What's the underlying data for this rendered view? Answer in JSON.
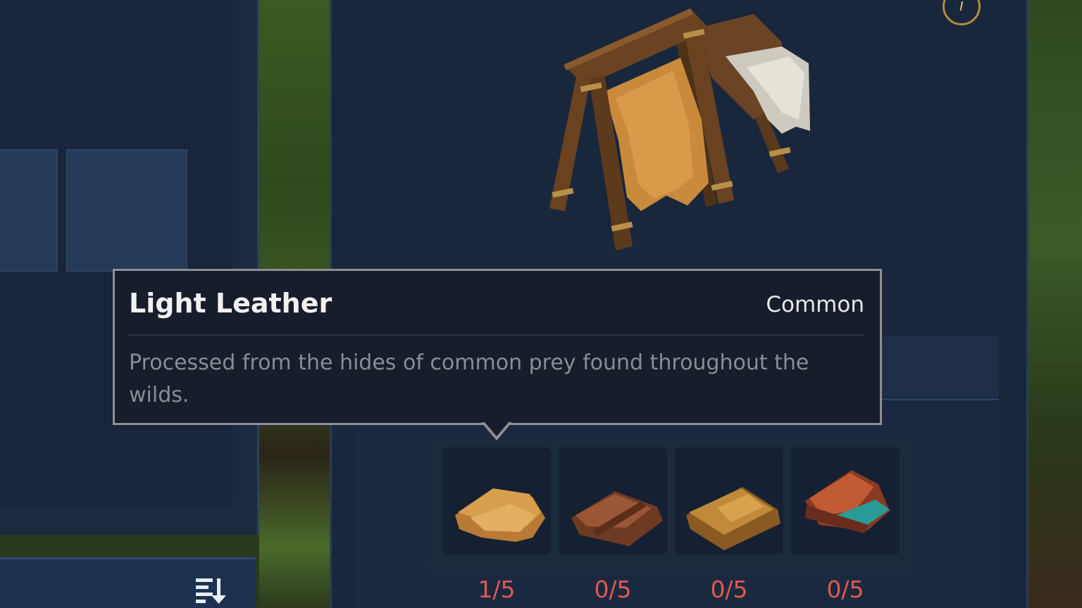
{
  "tooltip": {
    "title": "Light Leather",
    "rarity": "Common",
    "description": "Processed from the hides of common prey found throughout the wilds."
  },
  "recipe": {
    "station_icon": "tanning-rack-icon",
    "info_icon": "info-icon",
    "items": [
      {
        "name": "Light Leather",
        "icon": "light-leather-icon",
        "count": "1/5"
      },
      {
        "name": "",
        "icon": "dark-leather-icon",
        "count": "0/5"
      },
      {
        "name": "",
        "icon": "tan-leather-icon",
        "count": "0/5"
      },
      {
        "name": "",
        "icon": "red-teal-leather-icon",
        "count": "0/5"
      }
    ]
  },
  "inventory": {
    "sort_icon": "sort-icon"
  },
  "colors": {
    "count_missing": "#e05a4e",
    "tooltip_border": "#8c8f96",
    "panel_bg": "#19273d"
  }
}
